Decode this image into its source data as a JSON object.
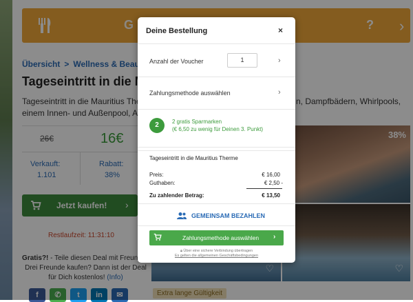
{
  "background": {
    "banner": {
      "ghost_text": "G",
      "ghost_q": "?",
      "color": "#f0a83a"
    },
    "breadcrumb": {
      "item1": "Übersicht",
      "separator": ">",
      "item2": "Wellness & Beauty"
    },
    "title": "Tageseintritt in die Ma",
    "description_line1_left": "Tageseintritt in die Mauritius The",
    "description_line1_right": "n, Dampfbädern, Whirlpools,",
    "description_line2": "einem Innen- und Außenpool, Au",
    "old_price": "26€",
    "new_price": "16€",
    "stat1": {
      "label": "Verkauft:",
      "value": "1.101"
    },
    "stat2": {
      "label": "Rabatt:",
      "value": "38%"
    },
    "buy_button": "Jetzt kaufen!",
    "remaining_time": "Restlaufzeit: 11:31:10",
    "gratis_text_bold": "Gratis?!",
    "gratis_text": " - Teile diesen Deal mit Freunden Drei Freunde kaufen? Dann ist der Deal für Dich kostenlos! ",
    "gratis_info": "(Info)",
    "photo_badge": "38%",
    "tag": "Extra lange Gültigkeit",
    "social_labels": [
      "f",
      "✆",
      "t",
      "in",
      "✉"
    ]
  },
  "modal": {
    "title": "Deine Bestellung",
    "close": "×",
    "voucher_label": "Anzahl der Voucher",
    "voucher_qty": "1",
    "payment_select_label": "Zahlungsmethode auswählen",
    "spar_number": "2",
    "spar_line1": "2 gratis Sparmarken",
    "spar_line2": "(€ 6,50 zu wenig für Deinen 3. Punkt)",
    "product": "Tageseintritt in die Mauritius Therme",
    "price_label": "Preis:",
    "price_value": "€ 16,00",
    "credit_label": "Guthaben:",
    "credit_value": "€ 2,50 -",
    "total_label": "Zu zahlender Betrag:",
    "total_value": "€ 13,50",
    "team_pay": "GEMEINSAM BEZAHLEN",
    "pay_button": "Zahlungsmethode auswählen",
    "pay_arrow": "›",
    "secure_note": "Über eine sichere Verbindung übertragen",
    "agb_note": "Es gelten die allgemeinen Geschäftsbedingungen"
  },
  "colors": {
    "green": "#3d9b3d",
    "blue": "#2a6bb5",
    "orange": "#f0a83a",
    "red": "#c9452a"
  }
}
